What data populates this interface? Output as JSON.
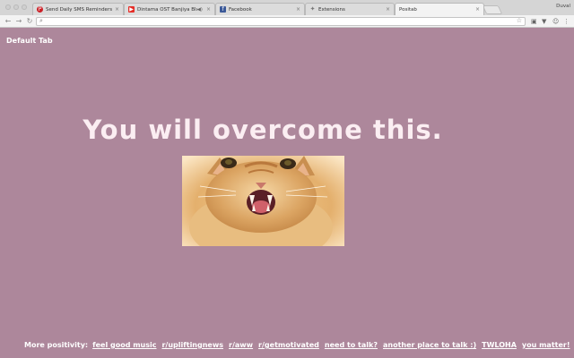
{
  "browser": {
    "tabs": [
      {
        "label": "Send Daily SMS Reminders Li",
        "icon": "pinterest-icon",
        "icon_color": "#cb2027",
        "active": false
      },
      {
        "label": "Dintama OST Banjiya Blue",
        "icon": "youtube-icon",
        "icon_color": "#e52d27",
        "active": false,
        "audio": true
      },
      {
        "label": "Facebook",
        "icon": "facebook-icon",
        "icon_color": "#3b5998",
        "active": false
      },
      {
        "label": "Extensions",
        "icon": "puzzle-icon",
        "icon_color": "#777777",
        "active": false
      },
      {
        "label": "Positab",
        "icon": "",
        "icon_color": "",
        "active": true
      }
    ],
    "profile_name": "Duval",
    "address": {
      "value": "",
      "placeholder": ""
    }
  },
  "page": {
    "default_tab_label": "Default Tab",
    "message": "You will overcome this.",
    "background_color": "#ad879b",
    "image_semantic": "hissing-kitten-photo",
    "footer": {
      "prefix": "More positivity:",
      "links": [
        "feel good music",
        "r/upliftingnews",
        "r/aww",
        "r/getmotivated",
        "need to talk?",
        "another place to talk :)",
        "TWLOHA",
        "you matter!"
      ]
    }
  }
}
